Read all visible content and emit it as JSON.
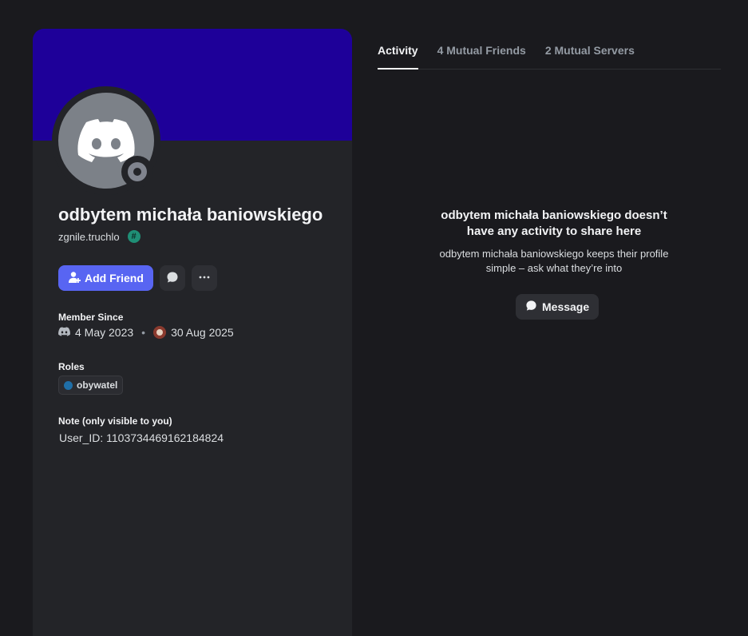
{
  "profile": {
    "display_name": "odbytem michała baniowskiego",
    "username": "zgnile.truchlo",
    "badge_symbol": "#",
    "colors": {
      "banner": "#1e0099",
      "accent": "#5865f2",
      "status_offline": "#80848e"
    },
    "actions": {
      "add_friend_label": "Add Friend",
      "add_friend_icon": "add-user-icon",
      "message_icon": "chat-bubble-icon",
      "more_icon": "more-horizontal-icon"
    },
    "member_since": {
      "label": "Member Since",
      "discord_date": "4 May 2023",
      "separator": "•",
      "server_date": "30 Aug 2025"
    },
    "roles": {
      "label": "Roles",
      "items": [
        {
          "name": "obywatel",
          "color": "#1f6fa8"
        }
      ]
    },
    "note": {
      "label": "Note (only visible to you)",
      "value": "User_ID: 1103734469162184824"
    }
  },
  "tabs": [
    {
      "label": "Activity",
      "active": true
    },
    {
      "label": "4 Mutual Friends",
      "active": false
    },
    {
      "label": "2 Mutual Servers",
      "active": false
    }
  ],
  "activity": {
    "empty_title": "odbytem michała baniowskiego doesn’t have any activity to share here",
    "empty_subtitle": "odbytem michała baniowskiego keeps their profile simple – ask what they’re into",
    "message_button_label": "Message"
  }
}
